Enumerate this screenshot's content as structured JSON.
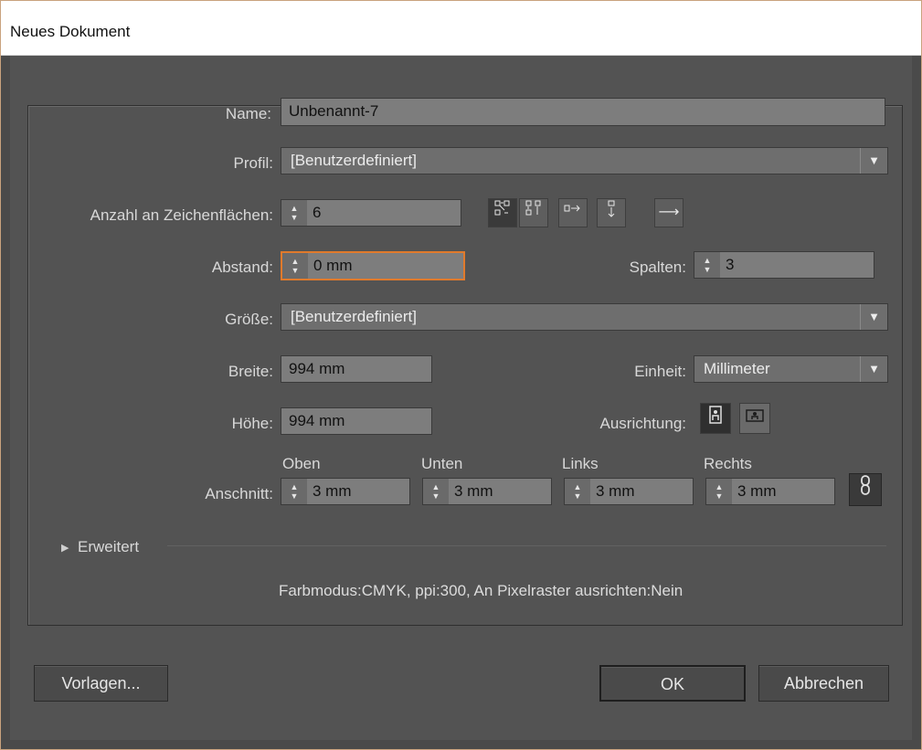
{
  "window": {
    "title": "Neues Dokument"
  },
  "name": {
    "label": "Name:",
    "value": "Unbenannt-7"
  },
  "profile": {
    "label": "Profil:",
    "value": "[Benutzerdefiniert]"
  },
  "artboards": {
    "label": "Anzahl an Zeichenflächen:",
    "value": "6",
    "layout_icons": [
      "grid-by-row-icon",
      "grid-by-column-icon",
      "arrange-by-row-icon",
      "arrange-by-column-icon"
    ],
    "direction_icon": "arrow-right-icon"
  },
  "spacing": {
    "label": "Abstand:",
    "value": "0 mm"
  },
  "columns": {
    "label": "Spalten:",
    "value": "3"
  },
  "size": {
    "label": "Größe:",
    "value": "[Benutzerdefiniert]"
  },
  "width": {
    "label": "Breite:",
    "value": "994 mm"
  },
  "unit": {
    "label": "Einheit:",
    "value": "Millimeter"
  },
  "height": {
    "label": "Höhe:",
    "value": "994 mm"
  },
  "orientation": {
    "label": "Ausrichtung:",
    "selected": "portrait"
  },
  "bleed": {
    "label": "Anschnitt:",
    "top_label": "Oben",
    "top": "3 mm",
    "bottom_label": "Unten",
    "bottom": "3 mm",
    "left_label": "Links",
    "left": "3 mm",
    "right_label": "Rechts",
    "right": "3 mm"
  },
  "advanced": {
    "label": "Erweitert"
  },
  "summary": "Farbmodus:CMYK, ppi:300, An Pixelraster ausrichten:Nein",
  "buttons": {
    "templates": "Vorlagen...",
    "ok": "OK",
    "cancel": "Abbrechen"
  },
  "colors": {
    "dialog_bg": "#535353",
    "focus_border": "#e07a2c",
    "field_bg": "#7d7d7d"
  }
}
